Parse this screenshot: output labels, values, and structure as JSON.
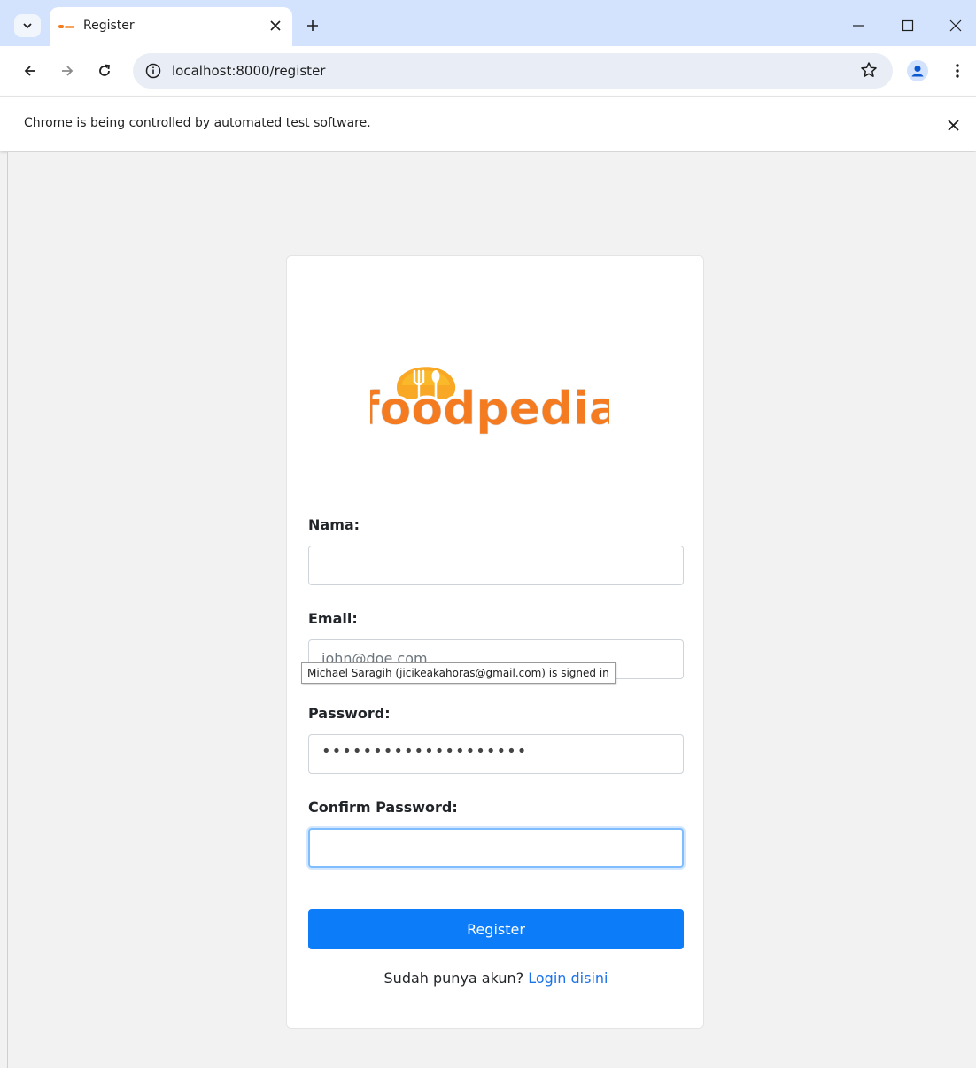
{
  "browser": {
    "tab": {
      "title": "Register"
    },
    "address": {
      "url": "localhost:8000/register"
    },
    "infobar": {
      "message": "Chrome is being controlled by automated test software."
    }
  },
  "page": {
    "logo_text": "foodpedia",
    "form": {
      "nama_label": "Nama:",
      "nama_value": "",
      "email_label": "Email:",
      "email_value": "john@doe.com",
      "password_label": "Password:",
      "password_mask": "••••••••••••••••••••",
      "confirm_label": "Confirm Password:",
      "confirm_value": "",
      "submit_label": "Register"
    },
    "autofill_tooltip": "Michael Saragih (jicikeakahoras@gmail.com) is signed in",
    "footer": {
      "prompt": "Sudah punya akun?",
      "link": "Login disini"
    }
  },
  "colors": {
    "accent": "#0d7cf8",
    "link": "#1a73e8",
    "logo_orange": "#f47b20"
  }
}
